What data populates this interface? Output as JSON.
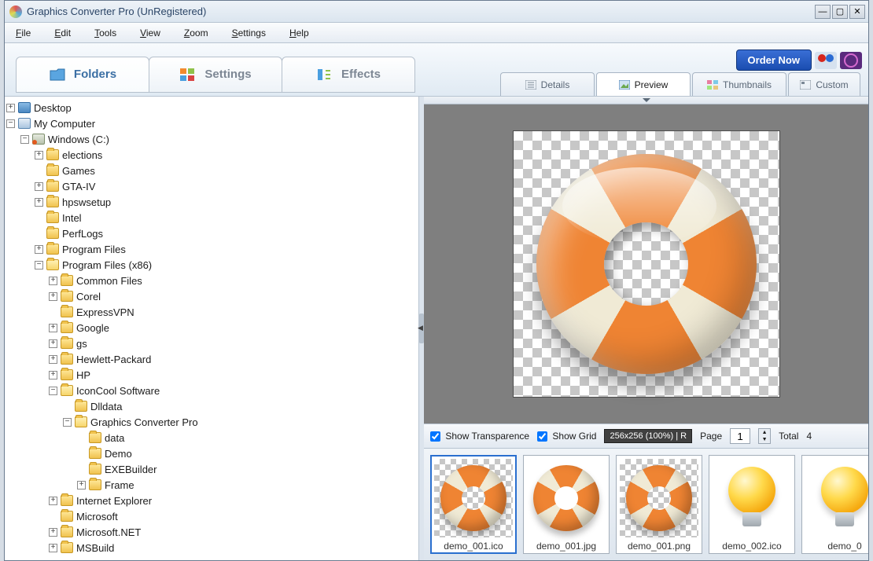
{
  "window": {
    "title": "Graphics Converter Pro  (UnRegistered)"
  },
  "menu": [
    "File",
    "Edit",
    "Tools",
    "View",
    "Zoom",
    "Settings",
    "Help"
  ],
  "maintabs": {
    "folders": "Folders",
    "settings": "Settings",
    "effects": "Effects"
  },
  "order": {
    "label": "Order Now"
  },
  "subtabs": {
    "details": "Details",
    "preview": "Preview",
    "thumbnails": "Thumbnails",
    "custom": "Custom"
  },
  "tree": {
    "desktop": "Desktop",
    "computer": "My Computer",
    "drive": "Windows (C:)",
    "folders_level3": [
      "elections",
      "Games",
      "GTA-IV",
      "hpswsetup",
      "Intel",
      "PerfLogs",
      "Program Files",
      "Program Files (x86)"
    ],
    "pfx86": [
      "Common Files",
      "Corel",
      "ExpressVPN",
      "Google",
      "gs",
      "Hewlett-Packard",
      "HP",
      "IconCool Software"
    ],
    "iconcool": [
      "Dlldata",
      "Graphics Converter Pro"
    ],
    "gcp": [
      "data",
      "Demo",
      "EXEBuilder",
      "Frame"
    ],
    "after_iconcool": [
      "Internet Explorer",
      "Microsoft",
      "Microsoft.NET",
      "MSBuild"
    ]
  },
  "expanders": {
    "elections": true,
    "Games": false,
    "GTA-IV": true,
    "hpswsetup": true,
    "Intel": false,
    "PerfLogs": false,
    "Program Files": true,
    "Common Files": true,
    "Corel": true,
    "ExpressVPN": false,
    "Google": true,
    "gs": true,
    "Hewlett-Packard": true,
    "HP": true,
    "Dlldata": false,
    "data": false,
    "Demo": false,
    "EXEBuilder": false,
    "Frame": true,
    "Internet Explorer": true,
    "Microsoft": false,
    "Microsoft.NET": true,
    "MSBuild": true
  },
  "controls": {
    "show_transparence": "Show Transparence",
    "show_grid": "Show Grid",
    "zoom_info": "256x256 (100%)  |  R",
    "page_label": "Page",
    "page_value": "1",
    "total_label": "Total",
    "total_value": "4"
  },
  "thumbs": [
    "demo_001.ico",
    "demo_001.jpg",
    "demo_001.png",
    "demo_002.ico",
    "demo_0"
  ]
}
